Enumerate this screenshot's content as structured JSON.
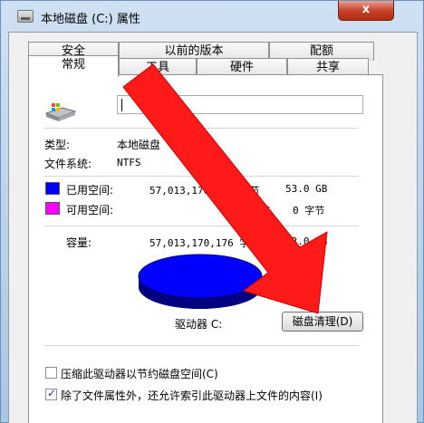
{
  "window": {
    "title": "本地磁盘 (C:) 属性",
    "close_label": "x"
  },
  "tabs": {
    "row1": [
      "安全",
      "以前的版本",
      "配额"
    ],
    "row2": [
      "常规",
      "工具",
      "硬件",
      "共享"
    ],
    "active": "常规"
  },
  "general": {
    "name_value": "",
    "type_label": "类型:",
    "type_value": "本地磁盘",
    "fs_label": "文件系统:",
    "fs_value": "NTFS",
    "used_label": "已用空间:",
    "used_bytes": "57,013,170,176 字节",
    "used_size": "53.0 GB",
    "free_label": "可用空间:",
    "free_bytes": "0 字节",
    "free_size": "0 字节",
    "capacity_label": "容量:",
    "capacity_bytes": "57,013,170,176 字节",
    "capacity_size": "53.0 GB",
    "drive_label": "驱动器 C:",
    "cleanup_button": "磁盘清理(D)",
    "compress_label": "压缩此驱动器以节约磁盘空间(C)",
    "compress_checked": false,
    "index_label": "除了文件属性外，还允许索引此驱动器上文件的内容(I)",
    "index_checked": true
  },
  "colors": {
    "used": "#0000ff",
    "free": "#ff00ff",
    "arrow": "#ff1a1a"
  },
  "icons": {
    "title": "drive-icon",
    "drive": "windows-drive-icon",
    "close": "close-icon"
  }
}
